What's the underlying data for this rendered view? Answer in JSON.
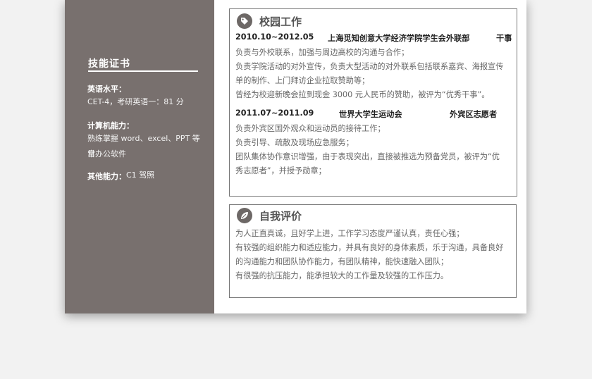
{
  "skills": {
    "title": "技能证书",
    "english_label": "英语水平：",
    "english_value": "CET-4，考研英语一：81 分",
    "computer_label": "计算机能力：",
    "computer_lines": [
      "熟练掌握 word、excel、PPT 等日",
      "常办公软件"
    ],
    "other_label": "其他能力：",
    "other_value": "C1 驾照"
  },
  "campus": {
    "title": "校园工作",
    "icon": "tag-icon",
    "entries": [
      {
        "date": "2010.10~2012.05",
        "org": "上海觅知创意大学经济学院学生会外联部",
        "role": "干事",
        "lines": [
          "负责与外校联系，加强与周边高校的沟通与合作；",
          "负责学院活动的对外宣传，负责大型活动的对外联系包括联系嘉宾、海报宣传",
          "单的制作、上门拜访企业拉取赞助等；",
          "曾经为校迎新晚会拉到现金 3000 元人民币的赞助，被评为“优秀干事”。"
        ]
      },
      {
        "date": "2011.07~2011.09",
        "org": "世界大学生运动会",
        "role": "外宾区志愿者",
        "lines": [
          "负责外宾区国外观众和运动员的接待工作；",
          "负责引导、疏散及现场应急服务；",
          "团队集体协作意识增强，由于表现突出，直接被推选为预备党员，被评为“优",
          "秀志愿者”，并授予勋章；"
        ]
      }
    ]
  },
  "self": {
    "title": "自我评价",
    "icon": "leaf-icon",
    "lines": [
      "为人正直真诚，且好学上进，工作学习态度严谨认真，责任心强；",
      "有较强的组织能力和适应能力，并具有良好的身体素质，乐于沟通，具备良好",
      "的沟通能力和团队协作能力，有团队精神，能快速融入团队；",
      "有很强的抗压能力，能承担较大的工作量及较强的工作压力。"
    ]
  }
}
